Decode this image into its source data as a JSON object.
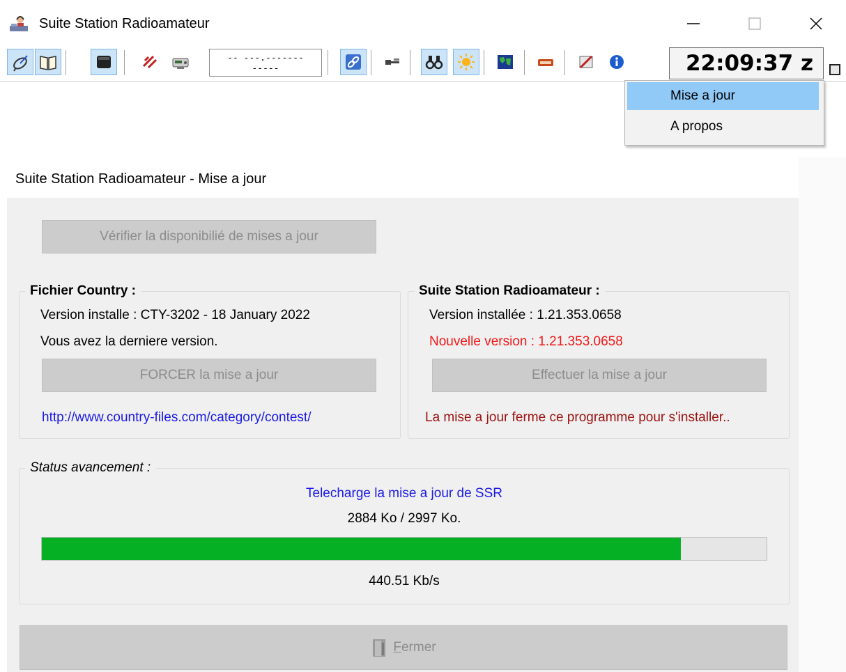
{
  "window": {
    "title": "Suite Station Radioamateur",
    "icon": "radio-operator-icon",
    "controls": [
      "minimize-icon",
      "maximize-icon",
      "close-icon"
    ]
  },
  "toolbar": {
    "buttons": [
      {
        "icon": "satellite-dish-icon",
        "active": true
      },
      {
        "icon": "book-icon",
        "active": true
      },
      {
        "icon": "terminal-icon",
        "active": true
      },
      {
        "icon": "lightning-icon",
        "active": false
      },
      {
        "icon": "radio-icon",
        "active": false
      },
      {
        "icon": "chain-link-icon",
        "active": true
      },
      {
        "icon": "cable-icon",
        "active": false
      },
      {
        "icon": "binoculars-icon",
        "active": true
      },
      {
        "icon": "sun-icon",
        "active": true
      },
      {
        "icon": "world-map-icon",
        "active": false
      },
      {
        "icon": "dx-spots-icon",
        "active": false
      },
      {
        "icon": "tools-icon",
        "active": false
      },
      {
        "icon": "info-icon",
        "active": false
      }
    ],
    "frequency": {
      "line1": "-- ---.-------",
      "line2": "-----"
    },
    "clock": "22:09:37 z"
  },
  "menu": {
    "items": [
      "Mise a jour",
      "A propos"
    ],
    "highlighted": "Mise a jour"
  },
  "dialog": {
    "title": "Suite Station Radioamateur - Mise a jour",
    "check_button": "Vérifier la disponibilié de mises a jour",
    "country": {
      "legend": "Fichier Country :",
      "version": "Version installe : CTY-3202 - 18 January 2022",
      "status": "Vous avez la derniere version.",
      "force_button": "FORCER la mise a jour",
      "link": "http://www.country-files.com/category/contest/"
    },
    "ssr": {
      "legend": "Suite Station Radioamateur :",
      "installed": "Version installée : 1.21.353.0658",
      "new_version": "Nouvelle version : 1.21.353.0658",
      "update_button": "Effectuer la mise a jour",
      "warning": "La mise a jour ferme ce programme pour s'installer.."
    },
    "status": {
      "legend": "Status avancement :",
      "message": "Telecharge la mise a jour de SSR",
      "size": "2884 Ko / 2997 Ko.",
      "progress": 0.882,
      "speed": "440.51 Kb/s"
    },
    "close_button": {
      "first_letter": "F",
      "rest": "ermer",
      "icon": "door-exit-icon"
    }
  },
  "colors": {
    "accent_highlight": "#91c9f7",
    "progress_green": "#06b025",
    "link_blue": "#1a1ae6",
    "error_red": "#f01818",
    "dark_red": "#9c1010"
  }
}
